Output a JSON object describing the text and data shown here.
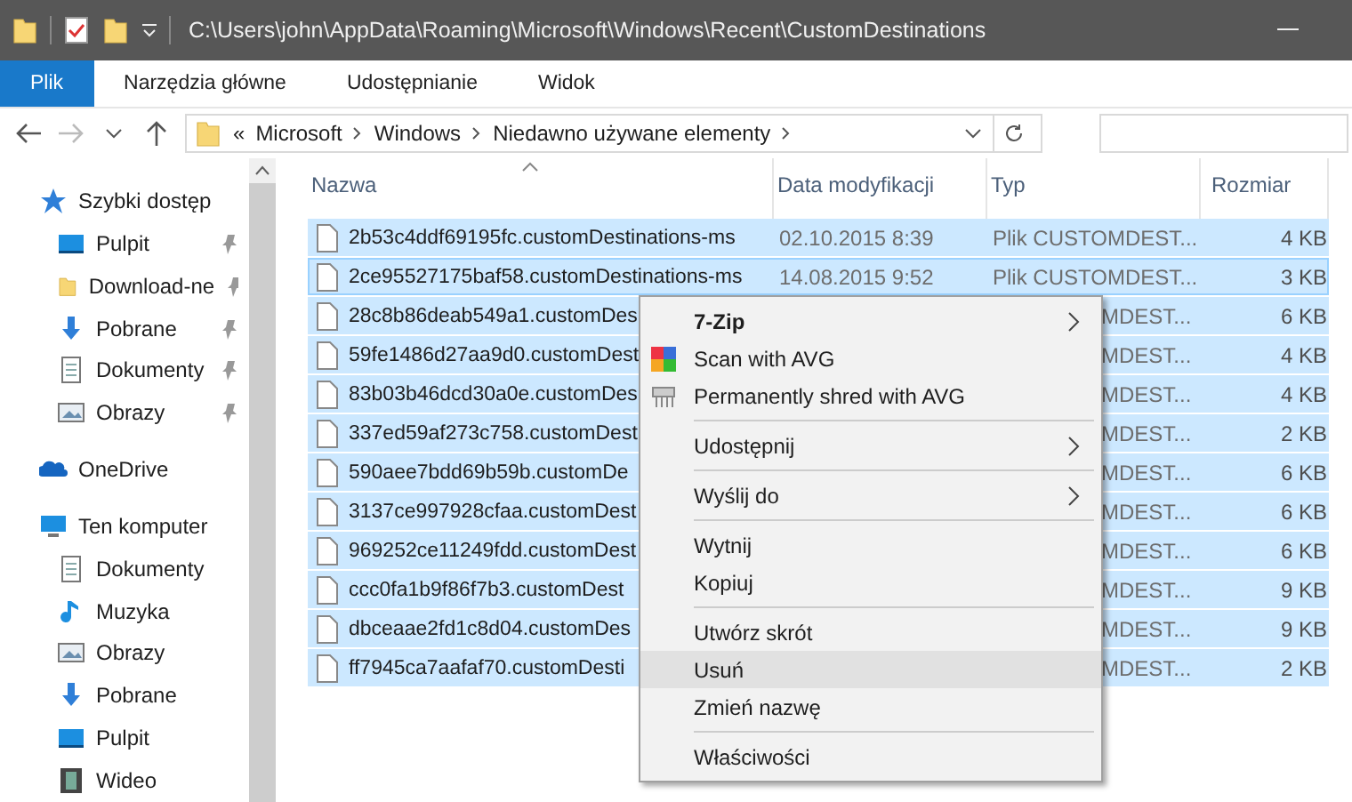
{
  "window": {
    "title": "C:\\Users\\john\\AppData\\Roaming\\Microsoft\\Windows\\Recent\\CustomDestinations"
  },
  "ribbon_tabs": [
    {
      "label": "Plik",
      "selected": true
    },
    {
      "label": "Narzędzia główne",
      "selected": false
    },
    {
      "label": "Udostępnianie",
      "selected": false
    },
    {
      "label": "Widok",
      "selected": false
    }
  ],
  "address": {
    "prefix": "«",
    "segments": [
      "Microsoft",
      "Windows",
      "Niedawno używane elementy"
    ]
  },
  "sidebar": [
    {
      "label": "Szybki dostęp",
      "kind": "star",
      "children": [
        {
          "label": "Pulpit",
          "kind": "desktop",
          "pinned": true
        },
        {
          "label": "Download-ne",
          "kind": "folder",
          "pinned": true
        },
        {
          "label": "Pobrane",
          "kind": "download",
          "pinned": true
        },
        {
          "label": "Dokumenty",
          "kind": "document",
          "pinned": true
        },
        {
          "label": "Obrazy",
          "kind": "pictures",
          "pinned": true
        }
      ]
    },
    {
      "label": "OneDrive",
      "kind": "cloud"
    },
    {
      "label": "Ten komputer",
      "kind": "computer",
      "children": [
        {
          "label": "Dokumenty",
          "kind": "document",
          "pinned": false
        },
        {
          "label": "Muzyka",
          "kind": "music",
          "pinned": false
        },
        {
          "label": "Obrazy",
          "kind": "pictures",
          "pinned": false
        },
        {
          "label": "Pobrane",
          "kind": "download",
          "pinned": false
        },
        {
          "label": "Pulpit",
          "kind": "desktop",
          "pinned": false
        },
        {
          "label": "Wideo",
          "kind": "video",
          "pinned": false
        }
      ]
    }
  ],
  "table": {
    "columns": [
      "Nazwa",
      "Data modyfikacji",
      "Typ",
      "Rozmiar"
    ],
    "rows": [
      {
        "name": "2b53c4ddf69195fc.customDestinations-ms",
        "date": "02.10.2015 8:39",
        "type": "Plik CUSTOMDEST...",
        "size": "4 KB",
        "selected": true,
        "focused": false,
        "covered": false
      },
      {
        "name": "2ce95527175baf58.customDestinations-ms",
        "date": "14.08.2015 9:52",
        "type": "Plik CUSTOMDEST...",
        "size": "3 KB",
        "selected": true,
        "focused": true,
        "covered": false
      },
      {
        "name": "28c8b86deab549a1.customDes",
        "type": "MDEST...",
        "size": "6 KB",
        "selected": true,
        "focused": false,
        "covered": true
      },
      {
        "name": "59fe1486d27aa9d0.customDest",
        "type": "MDEST...",
        "size": "4 KB",
        "selected": true,
        "focused": false,
        "covered": true
      },
      {
        "name": "83b03b46dcd30a0e.customDes",
        "type": "MDEST...",
        "size": "4 KB",
        "selected": true,
        "focused": false,
        "covered": true
      },
      {
        "name": "337ed59af273c758.customDest",
        "type": "MDEST...",
        "size": "2 KB",
        "selected": true,
        "focused": false,
        "covered": true
      },
      {
        "name": "590aee7bdd69b59b.customDe",
        "type": "MDEST...",
        "size": "6 KB",
        "selected": true,
        "focused": false,
        "covered": true
      },
      {
        "name": "3137ce997928cfaa.customDest",
        "type": "MDEST...",
        "size": "6 KB",
        "selected": true,
        "focused": false,
        "covered": true
      },
      {
        "name": "969252ce11249fdd.customDest",
        "type": "MDEST...",
        "size": "6 KB",
        "selected": true,
        "focused": false,
        "covered": true
      },
      {
        "name": "ccc0fa1b9f86f7b3.customDest",
        "type": "MDEST...",
        "size": "9 KB",
        "selected": true,
        "focused": false,
        "covered": true
      },
      {
        "name": "dbceaae2fd1c8d04.customDes",
        "type": "MDEST...",
        "size": "9 KB",
        "selected": true,
        "focused": false,
        "covered": true
      },
      {
        "name": "ff7945ca7aafaf70.customDesti",
        "type": "MDEST...",
        "size": "2 KB",
        "selected": true,
        "focused": false,
        "covered": true
      }
    ]
  },
  "context_menu": [
    [
      {
        "label": "7-Zip",
        "bold": true,
        "submenu": true,
        "selected": false
      },
      {
        "label": "Scan with AVG",
        "kind": "avg-scan",
        "bold": false,
        "submenu": false,
        "selected": false
      },
      {
        "label": "Permanently shred with AVG",
        "kind": "avg-shred",
        "bold": false,
        "submenu": false,
        "selected": false
      }
    ],
    [
      {
        "label": "Udostępnij",
        "bold": false,
        "submenu": true,
        "selected": false
      }
    ],
    [
      {
        "label": "Wyślij do",
        "bold": false,
        "submenu": true,
        "selected": false
      }
    ],
    [
      {
        "label": "Wytnij",
        "bold": false,
        "submenu": false,
        "selected": false
      },
      {
        "label": "Kopiuj",
        "bold": false,
        "submenu": false,
        "selected": false
      }
    ],
    [
      {
        "label": "Utwórz skrót",
        "bold": false,
        "submenu": false,
        "selected": false
      },
      {
        "label": "Usuń",
        "bold": false,
        "submenu": false,
        "selected": true
      },
      {
        "label": "Zmień nazwę",
        "bold": false,
        "submenu": false,
        "selected": false
      }
    ],
    [
      {
        "label": "Właściwości",
        "bold": false,
        "submenu": false,
        "selected": false
      }
    ]
  ]
}
